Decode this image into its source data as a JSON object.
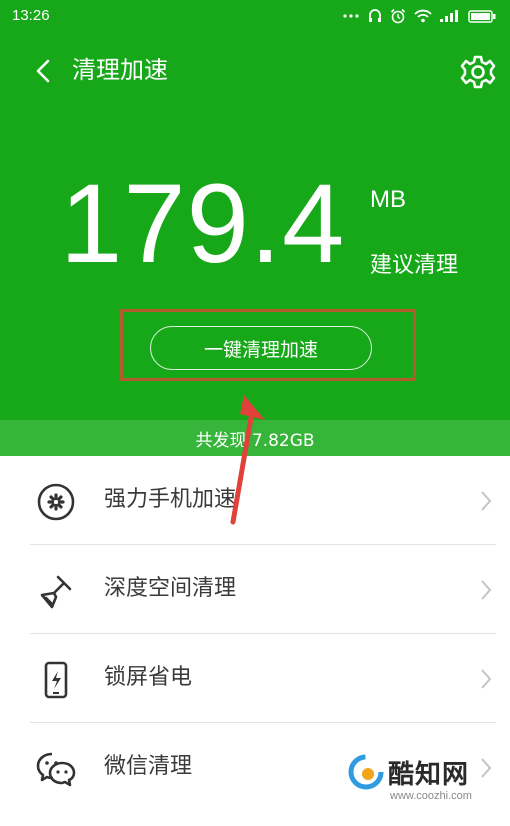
{
  "status_bar": {
    "time": "13:26"
  },
  "header": {
    "title": "清理加速",
    "back_icon": "chevron-left-icon",
    "settings_icon": "gear-icon",
    "background_color": "#17a81a"
  },
  "junk": {
    "value": "179.4",
    "unit": "MB",
    "hint": "建议清理",
    "button_label": "一键清理加速"
  },
  "summary": {
    "text": "共发现 7.82GB"
  },
  "list": {
    "items": [
      {
        "label": "强力手机加速",
        "icon": "fan-icon"
      },
      {
        "label": "深度空间清理",
        "icon": "broom-icon"
      },
      {
        "label": "锁屏省电",
        "icon": "phone-battery-icon"
      },
      {
        "label": "微信清理",
        "icon": "wechat-icon"
      }
    ]
  },
  "annotation": {
    "box_color": "#b25b2c",
    "arrow_color": "#e0413a"
  },
  "watermark": {
    "name": "酷知网",
    "url": "www.coozhi.com"
  }
}
